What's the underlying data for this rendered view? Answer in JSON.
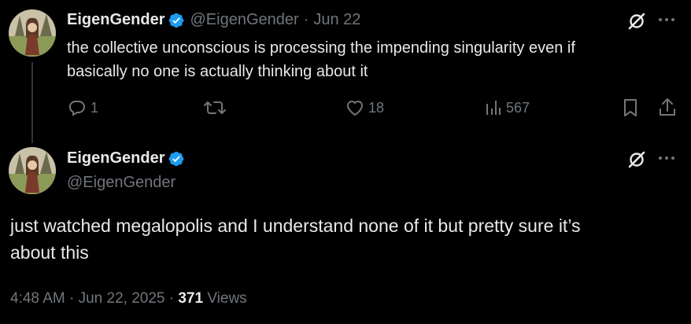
{
  "reply_tweet": {
    "display_name": "EigenGender",
    "handle": "@EigenGender",
    "separator": "·",
    "time": "Jun 22",
    "text_line1": "the collective unconscious is processing the impending singularity even if",
    "text_line2": "basically no one is actually thinking about it",
    "replies": "1",
    "likes": "18",
    "views": "567"
  },
  "main_tweet": {
    "display_name": "EigenGender",
    "handle": "@EigenGender",
    "text_line1": "just watched megalopolis and I understand none of it but pretty sure it’s",
    "text_line2": "about this",
    "timestamp": "4:48 AM · Jun 22, 2025 ·",
    "views_count": "371",
    "views_label": "Views"
  },
  "colors": {
    "background": "#000000",
    "text": "#e7e9ea",
    "muted": "#71767b",
    "verified": "#1d9bf0"
  },
  "icons": [
    "verified-badge-icon",
    "grok-icon",
    "more-icon",
    "reply-icon",
    "retweet-icon",
    "like-icon",
    "views-icon",
    "bookmark-icon",
    "share-icon"
  ]
}
